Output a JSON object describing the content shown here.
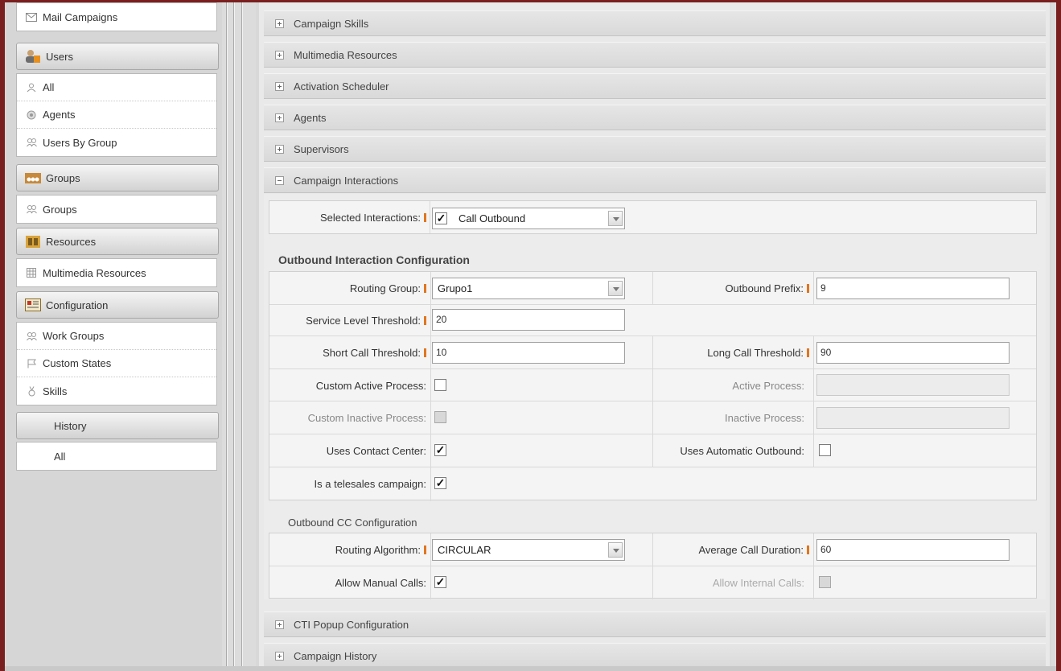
{
  "sidebar": {
    "mail_campaigns": "Mail Campaigns",
    "users_header": "Users",
    "users_items": [
      "All",
      "Agents",
      "Users By Group"
    ],
    "groups_header": "Groups",
    "groups_items": [
      "Groups"
    ],
    "resources_header": "Resources",
    "resources_items": [
      "Multimedia Resources"
    ],
    "configuration_header": "Configuration",
    "configuration_items": [
      "Work Groups",
      "Custom States",
      "Skills"
    ],
    "history_header": "History",
    "history_items": [
      "All"
    ]
  },
  "accordion": {
    "campaign_skills": "Campaign Skills",
    "multimedia_resources": "Multimedia Resources",
    "activation_scheduler": "Activation Scheduler",
    "agents": "Agents",
    "supervisors": "Supervisors",
    "campaign_interactions": "Campaign Interactions",
    "cti_popup": "CTI Popup Configuration",
    "campaign_history": "Campaign History"
  },
  "interactions": {
    "selected_label": "Selected Interactions:",
    "selected_value": "Call Outbound",
    "selected_checked": true
  },
  "outbound": {
    "title": "Outbound Interaction Configuration",
    "routing_group_label": "Routing Group:",
    "routing_group_value": "Grupo1",
    "outbound_prefix_label": "Outbound Prefix:",
    "outbound_prefix_value": "9",
    "service_level_label": "Service Level Threshold:",
    "service_level_value": "20",
    "short_call_label": "Short Call Threshold:",
    "short_call_value": "10",
    "long_call_label": "Long Call Threshold:",
    "long_call_value": "90",
    "custom_active_label": "Custom Active Process:",
    "active_process_label": "Active Process:",
    "custom_inactive_label": "Custom Inactive Process:",
    "inactive_process_label": "Inactive Process:",
    "uses_cc_label": "Uses Contact Center:",
    "uses_auto_label": "Uses Automatic Outbound:",
    "telesales_label": "Is a telesales campaign:"
  },
  "cc": {
    "title": "Outbound CC Configuration",
    "routing_algorithm_label": "Routing Algorithm:",
    "routing_algorithm_value": "CIRCULAR",
    "avg_call_label": "Average Call Duration:",
    "avg_call_value": "60",
    "manual_calls_label": "Allow Manual Calls:",
    "internal_calls_label": "Allow Internal Calls:"
  },
  "checkmark": "✓"
}
